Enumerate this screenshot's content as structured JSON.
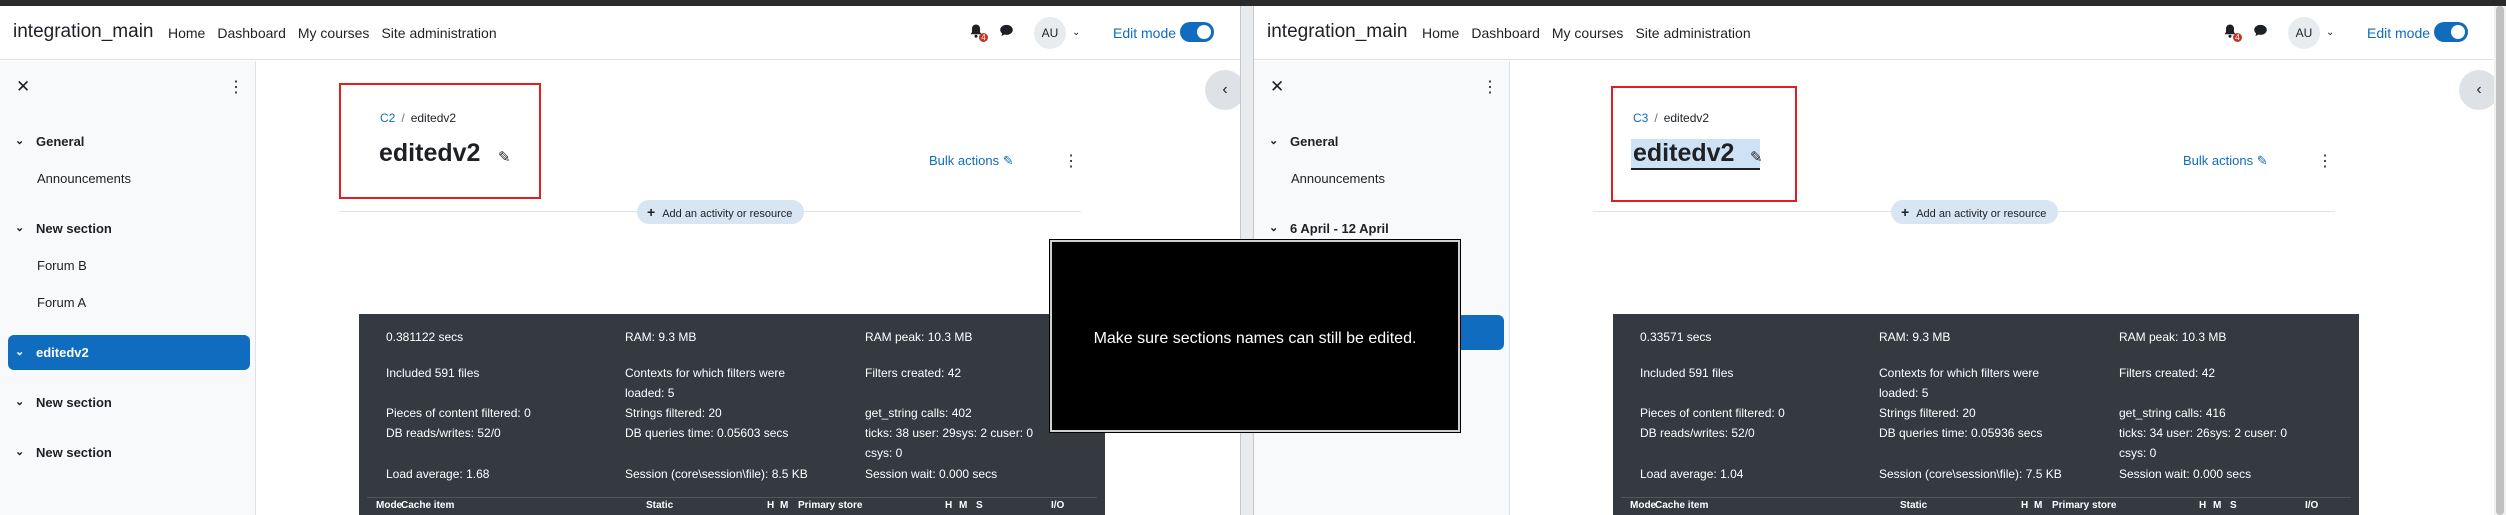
{
  "left": {
    "brand": "integration_main",
    "nav": [
      "Home",
      "Dashboard",
      "My courses",
      "Site administration"
    ],
    "notif_count": "4",
    "avatar": "AU",
    "edit_mode_label": "Edit mode",
    "drawer": {
      "items": [
        {
          "label": "General",
          "type": "section"
        },
        {
          "label": "Announcements",
          "type": "sub"
        },
        {
          "label": "New section",
          "type": "section"
        },
        {
          "label": "Forum B",
          "type": "sub"
        },
        {
          "label": "Forum A",
          "type": "sub"
        },
        {
          "label": "editedv2",
          "type": "active"
        },
        {
          "label": "New section",
          "type": "section"
        },
        {
          "label": "New section",
          "type": "section"
        }
      ]
    },
    "breadcrumb": {
      "course": "C2",
      "current": "editedv2"
    },
    "title": "editedv2",
    "bulk_actions": "Bulk actions",
    "add_activity": "Add an activity or resource",
    "perf": {
      "secs": "0.381122 secs",
      "ram": "RAM: 9.3 MB",
      "ram_peak": "RAM peak: 10.3 MB",
      "included": "Included 591 files",
      "contexts_1": "Contexts for which filters were",
      "contexts_2": "loaded: 5",
      "filters_created": "Filters created: 42",
      "pieces": "Pieces of content filtered: 0",
      "strings": "Strings filtered: 20",
      "get_string": "get_string calls: 402",
      "db_rw": "DB reads/writes: 52/0",
      "db_time": "DB queries time: 0.05603 secs",
      "ticks_1": "ticks: 38 user: 29sys: 2 cuser: 0",
      "ticks_2": "csys: 0",
      "load": "Load average: 1.68",
      "session": "Session (core\\session\\file): 8.5 KB",
      "session_wait": "Session wait: 0.000 secs",
      "headers": [
        "Mode",
        "Cache item",
        "Static",
        "H",
        "M",
        "Primary store",
        "H",
        "M",
        "S",
        "I/O"
      ]
    }
  },
  "right": {
    "brand": "integration_main",
    "nav": [
      "Home",
      "Dashboard",
      "My courses",
      "Site administration"
    ],
    "notif_count": "4",
    "avatar": "AU",
    "edit_mode_label": "Edit mode",
    "drawer": {
      "items": [
        {
          "label": "General",
          "type": "section"
        },
        {
          "label": "Announcements",
          "type": "sub"
        },
        {
          "label": "6 April - 12 April",
          "type": "section"
        }
      ]
    },
    "breadcrumb": {
      "course": "C3",
      "current": "editedv2"
    },
    "title": "editedv2",
    "bulk_actions": "Bulk actions",
    "add_activity": "Add an activity or resource",
    "perf": {
      "secs": "0.33571 secs",
      "ram": "RAM: 9.3 MB",
      "ram_peak": "RAM peak: 10.3 MB",
      "included": "Included 591 files",
      "contexts_1": "Contexts for which filters were",
      "contexts_2": "loaded: 5",
      "filters_created": "Filters created: 42",
      "pieces": "Pieces of content filtered: 0",
      "strings": "Strings filtered: 20",
      "get_string": "get_string calls: 416",
      "db_rw": "DB reads/writes: 52/0",
      "db_time": "DB queries time: 0.05936 secs",
      "ticks_1": "ticks: 34 user: 26sys: 2 cuser: 0",
      "ticks_2": "csys: 0",
      "load": "Load average: 1.04",
      "session": "Session (core\\session\\file): 7.5 KB",
      "session_wait": "Session wait: 0.000 secs",
      "headers": [
        "Mode",
        "Cache item",
        "Static",
        "H",
        "M",
        "Primary store",
        "H",
        "M",
        "S",
        "I/O"
      ]
    }
  },
  "toast": {
    "message": "Make sure sections names can still be edited."
  },
  "colors": {
    "accent": "#0f6cbf",
    "highlight_box": "#e02020",
    "perf_bg": "#343a40"
  }
}
